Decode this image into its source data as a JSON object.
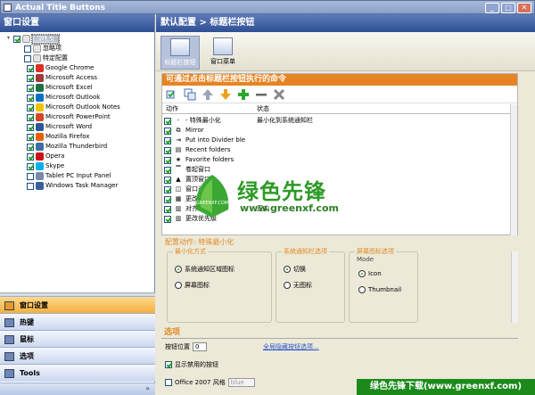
{
  "window": {
    "title": "Actual Title Buttons"
  },
  "left": {
    "header": "窗口设置",
    "tree": [
      {
        "label": "默认配置",
        "checked": true,
        "level": 0,
        "selected": true
      },
      {
        "label": "忽略项",
        "checked": false,
        "level": 1
      },
      {
        "label": "特定配置",
        "checked": false,
        "level": 1
      },
      {
        "label": "Google Chrome",
        "checked": true,
        "level": 2,
        "color": "#d93025"
      },
      {
        "label": "Microsoft Access",
        "checked": true,
        "level": 2,
        "color": "#a4373a"
      },
      {
        "label": "Microsoft Excel",
        "checked": true,
        "level": 2,
        "color": "#1e7145"
      },
      {
        "label": "Microsoft Outlook",
        "checked": true,
        "level": 2,
        "color": "#0072c6"
      },
      {
        "label": "Microsoft Outlook Notes",
        "checked": true,
        "level": 2,
        "color": "#f2c200"
      },
      {
        "label": "Microsoft PowerPoint",
        "checked": true,
        "level": 2,
        "color": "#d24726"
      },
      {
        "label": "Microsoft Word",
        "checked": true,
        "level": 2,
        "color": "#2b579a"
      },
      {
        "label": "Mozilla Firefox",
        "checked": true,
        "level": 2,
        "color": "#e66000"
      },
      {
        "label": "Mozilla Thunderbird",
        "checked": true,
        "level": 2,
        "color": "#3b6ea5"
      },
      {
        "label": "Opera",
        "checked": true,
        "level": 2,
        "color": "#cc0f16"
      },
      {
        "label": "Skype",
        "checked": true,
        "level": 2,
        "color": "#00aff0"
      },
      {
        "label": "Tablet PC Input Panel",
        "checked": false,
        "level": 2,
        "color": "#7a8aa8"
      },
      {
        "label": "Windows Task Manager",
        "checked": false,
        "level": 2,
        "color": "#3a5f9a"
      }
    ],
    "nav": [
      {
        "label": "窗口设置",
        "active": true
      },
      {
        "label": "热键",
        "active": false
      },
      {
        "label": "鼠标",
        "active": false
      },
      {
        "label": "选项",
        "active": false
      },
      {
        "label": "Tools",
        "active": false
      }
    ],
    "nav_more": "»"
  },
  "right": {
    "header": "默认配置 > 标题栏按钮",
    "toolbar": [
      {
        "label": "标题栏按钮",
        "active": true
      },
      {
        "label": "窗口菜单",
        "active": false
      }
    ],
    "commands": {
      "title": "可通过点击标题栏按钮执行的命令",
      "columns": {
        "action": "动作",
        "status": "状态"
      },
      "rows": [
        {
          "icon": "-",
          "label": "- 特殊最小化",
          "status": "最小化到系统通知栏"
        },
        {
          "icon": "⧉",
          "label": "Mirror",
          "status": ""
        },
        {
          "icon": "⇥",
          "label": "Put into Divider ble",
          "status": ""
        },
        {
          "icon": "▤",
          "label": "Recent folders",
          "status": ""
        },
        {
          "icon": "★",
          "label": "Favorite folders",
          "status": ""
        },
        {
          "icon": "▔",
          "label": "卷起窗口",
          "status": ""
        },
        {
          "icon": "▲",
          "label": "置顶窗口",
          "status": ""
        },
        {
          "icon": "◫",
          "label": "窗口透明",
          "status": ""
        },
        {
          "icon": "▦",
          "label": "更改大小",
          "status": ""
        },
        {
          "icon": "▥",
          "label": "对齐",
          "status": "正中"
        },
        {
          "icon": "▥",
          "label": "更改优先级",
          "status": ""
        }
      ]
    },
    "config": {
      "title": "配置动作: 特殊最小化",
      "groups": [
        {
          "title": "最小化方式",
          "options": [
            {
              "label": "系统通知区域图标",
              "on": true
            },
            {
              "label": "屏幕图标",
              "on": false
            }
          ]
        },
        {
          "title": "系统通知栏选项",
          "options": [
            {
              "label": "切换",
              "on": true
            },
            {
              "label": "无图标",
              "on": false
            }
          ]
        },
        {
          "title": "屏幕图标选项",
          "mode_label": "Mode",
          "options": [
            {
              "label": "Icon",
              "on": true
            },
            {
              "label": "Thumbnail",
              "on": false
            }
          ]
        }
      ]
    },
    "options": {
      "title": "选项",
      "button_position_label": "按钮位置",
      "button_position_value": "0",
      "global_link": "全局隐藏按钮选项...",
      "show_disabled": "显示禁用的按钮",
      "office_style": "Office 2007 风格",
      "office_style_value": "blue"
    }
  },
  "watermark": {
    "title": "绿色先锋",
    "url": "www.greenxf.com",
    "logo_text": "GREENXF.COM"
  },
  "footer_banner": "绿色先锋下载(www.greenxf.com)"
}
